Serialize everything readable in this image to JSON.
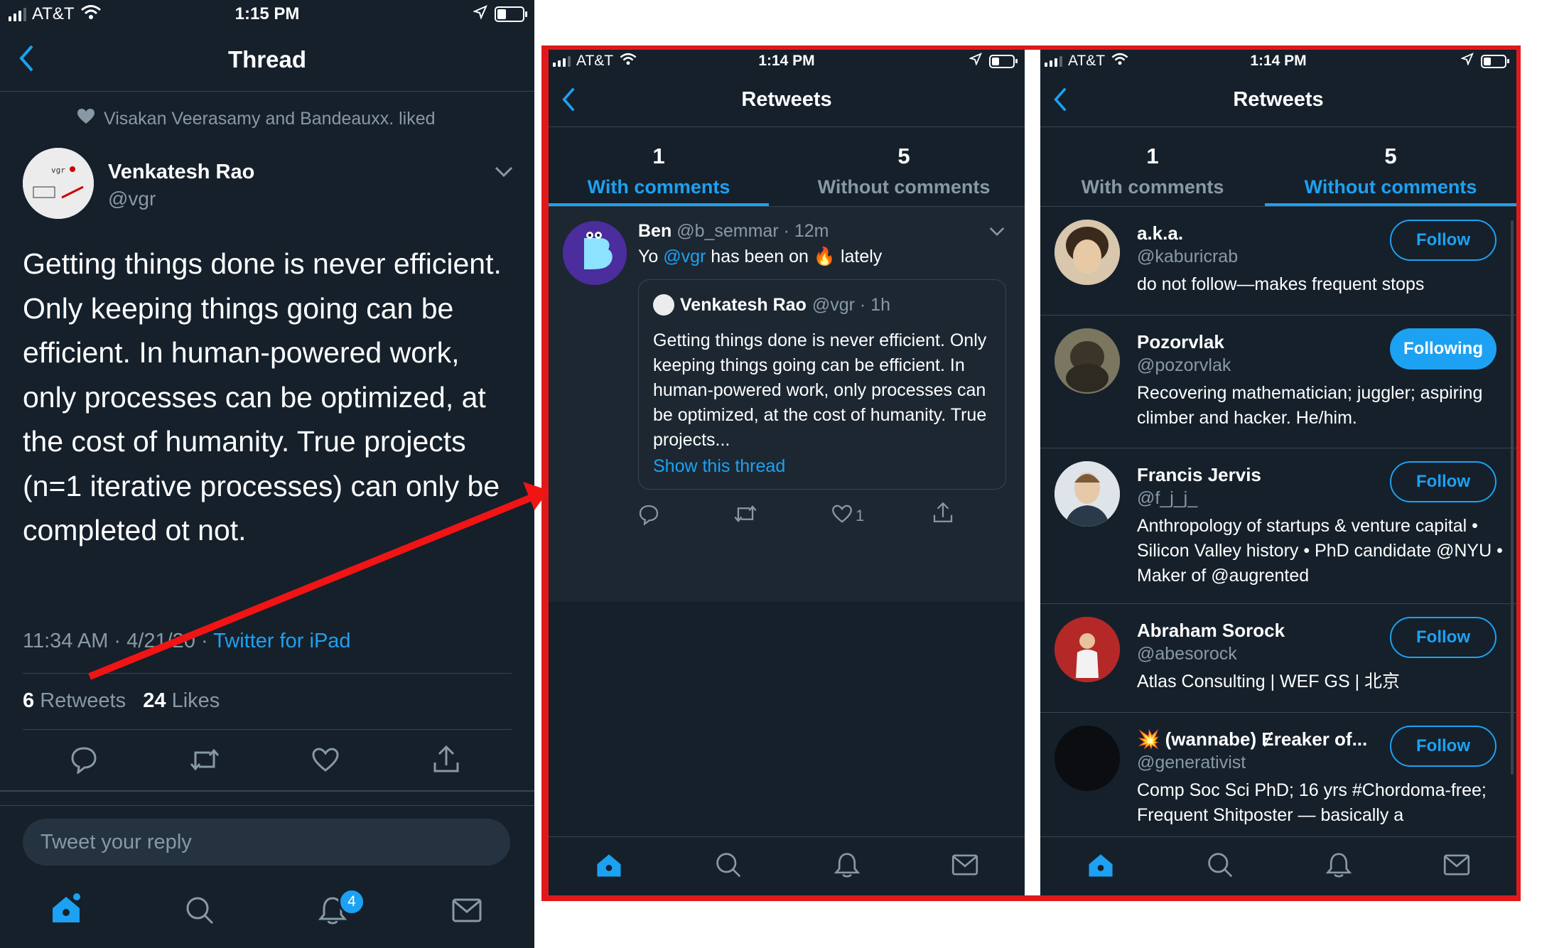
{
  "left": {
    "status": {
      "carrier": "AT&T",
      "time": "1:15 PM"
    },
    "nav": {
      "title": "Thread"
    },
    "liked_line": "Visakan Veerasamy and Bandeauxx. liked",
    "author": {
      "name": "Venkatesh Rao",
      "handle": "@vgr"
    },
    "tweet_text": "Getting things done is never efficient. Only keeping things going can be efficient. In human-powered work, only processes can be optimized, at the cost of humanity. True projects (n=1 iterative processes) can only be completed ot not.",
    "meta": {
      "timestamp": "11:34 AM · 4/21/20 · ",
      "source": "Twitter for iPad"
    },
    "stats": {
      "retweets_count": "6",
      "retweets_label": "Retweets",
      "likes_count": "24",
      "likes_label": "Likes"
    },
    "reply_placeholder": "Tweet your reply",
    "notification_badge": "4"
  },
  "middle": {
    "status": {
      "carrier": "AT&T",
      "time": "1:14 PM"
    },
    "nav": {
      "title": "Retweets"
    },
    "tabs": [
      {
        "count": "1",
        "label": "With comments"
      },
      {
        "count": "5",
        "label": "Without comments"
      }
    ],
    "tweet": {
      "name": "Ben",
      "handle": "@b_semmar · 12m",
      "text_before": "Yo ",
      "mention": "@vgr",
      "text_middle": " has been on ",
      "emoji": "🔥",
      "text_after": " lately",
      "like_count": "1",
      "quoted": {
        "name": "Venkatesh Rao",
        "handle": "@vgr · 1h",
        "text": "Getting things done is never efficient. Only keeping things going can be efficient. In human-powered work, only processes can be optimized, at the cost of humanity. True projects...",
        "link": "Show this thread"
      }
    }
  },
  "right": {
    "status": {
      "carrier": "AT&T",
      "time": "1:14 PM"
    },
    "nav": {
      "title": "Retweets"
    },
    "tabs": [
      {
        "count": "1",
        "label": "With comments"
      },
      {
        "count": "5",
        "label": "Without comments"
      }
    ],
    "users": [
      {
        "name": "a.k.a.",
        "handle": "@kaburicrab",
        "bio": "do not follow—makes frequent stops",
        "button": "Follow"
      },
      {
        "name": "Pozorvlak",
        "handle": "@pozorvlak",
        "bio": "Recovering mathematician; juggler; aspiring climber and hacker. He/him.",
        "button": "Following"
      },
      {
        "name": "Francis Jervis",
        "handle": "@f_j_j_",
        "bio": "Anthropology of startups & venture capital • Silicon Valley history • PhD candidate @NYU • Maker of @augrented",
        "button": "Follow"
      },
      {
        "name": "Abraham Sorock",
        "handle": "@abesorock",
        "bio": "Atlas Consulting | WEF GS | 北京",
        "button": "Follow"
      },
      {
        "name": "(wannabe) Ɇreaker of...",
        "emoji": "💥",
        "handle": "@generativist",
        "bio": "Comp Soc Sci PhD; 16 yrs #Chordoma-free; Frequent Shitposter — basically a",
        "button": "Follow"
      }
    ]
  },
  "colors": {
    "accent": "#1da1f2",
    "background": "#15202b",
    "highlight_frame": "#e0191b",
    "arrow": "#f01414"
  }
}
